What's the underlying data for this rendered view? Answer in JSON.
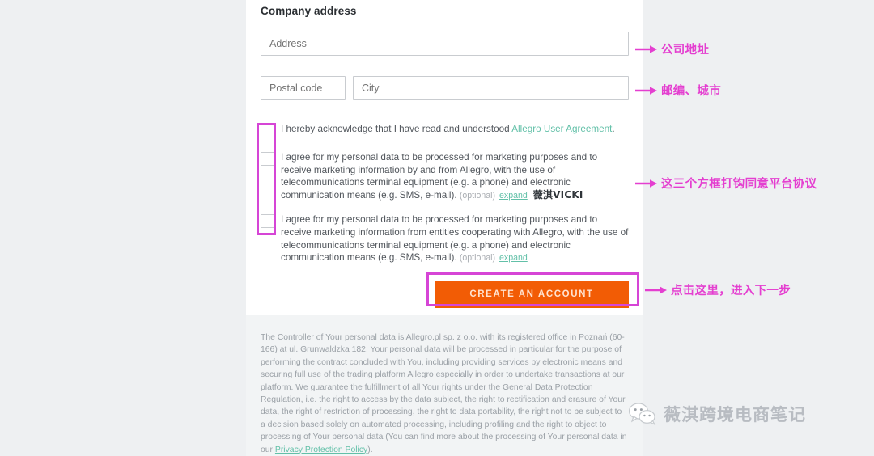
{
  "form": {
    "section_title": "Company address",
    "address_placeholder": "Address",
    "postal_placeholder": "Postal code",
    "city_placeholder": "City",
    "consents": [
      {
        "text_before": "I hereby acknowledge that I have read and understood ",
        "link": "Allegro User Agreement",
        "text_after": ".",
        "optional": "",
        "expand": ""
      },
      {
        "text_before": "I agree for my personal data to be processed for marketing purposes and to receive marketing information by and from Allegro, with the use of telecommunications terminal equipment (e.g. a phone) and electronic communication means (e.g. SMS, e-mail).",
        "link": "",
        "text_after": "",
        "optional": "(optional)",
        "expand": "expand",
        "inline_watermark": "薇淇VICKI"
      },
      {
        "text_before": "I agree for my personal data to be processed for marketing purposes and to receive marketing information from entities cooperating with Allegro, with the use of telecommunications terminal equipment (e.g. a phone) and electronic communication means (e.g. SMS, e-mail).",
        "link": "",
        "text_after": "",
        "optional": "(optional)",
        "expand": "expand"
      }
    ],
    "cta_label": "CREATE AN ACCOUNT"
  },
  "legal": {
    "part1": "The Controller of Your personal data is Allegro.pl sp. z o.o. with its registered office in Poznań (60-166) at ul. Grunwaldzka 182. Your personal data will be processed in particular for the purpose of performing the contract concluded with You, including providing services by electronic means and securing full use of the trading platform Allegro especially in order to undertake transactions at our platform. We guarantee the fulfillment of all Your rights under the General Data Protection Regulation, i.e. the right to access by the data subject, the right to rectification and erasure of Your data, the right of restriction of processing, the right to data portability, the right not to be subject to a decision based solely on automated processing, including profiling and the right to object to processing of Your personal data (You can find more about the processing of Your personal data in our ",
    "link": "Privacy Protection Policy",
    "part2": ")."
  },
  "annotations": {
    "accent_color": "#e43fd0",
    "box_color": "#d645d6",
    "address": "公司地址",
    "postal": "邮编、城市",
    "checkboxes": "这三个方框打钩同意平台协议",
    "cta": "点击这里，进入下一步"
  },
  "watermark": {
    "icon": "wechat-icon",
    "text": "薇淇跨境电商笔记"
  }
}
